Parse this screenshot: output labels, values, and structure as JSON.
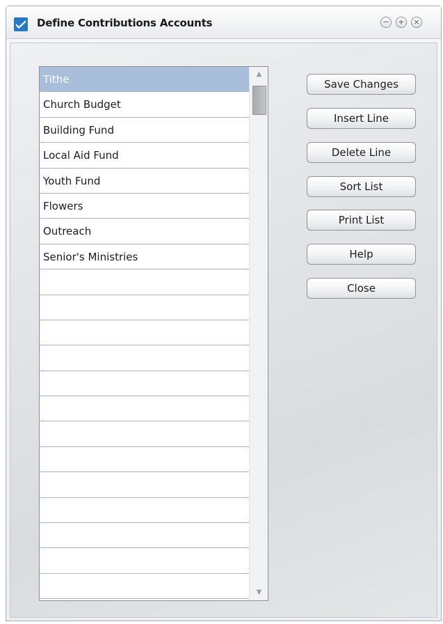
{
  "window": {
    "title": "Define Contributions Accounts",
    "controls": {
      "minimize": "−",
      "maximize": "+",
      "close": "×"
    }
  },
  "accounts": {
    "items": [
      "Tithe",
      "Church Budget",
      "Building Fund",
      "Local Aid Fund",
      "Youth Fund",
      "Flowers",
      "Outreach",
      "Senior's Ministries",
      "",
      "",
      "",
      "",
      "",
      "",
      "",
      "",
      "",
      "",
      "",
      "",
      ""
    ],
    "selected_index": 0
  },
  "buttons": {
    "save": "Save Changes",
    "insert": "Insert Line",
    "delete": "Delete Line",
    "sort": "Sort List",
    "print": "Print List",
    "help": "Help",
    "close": "Close"
  },
  "scroll": {
    "up_arrow": "▲",
    "down_arrow": "▼"
  },
  "colors": {
    "selection": "#a9bedb",
    "app_icon": "#2a78bf"
  },
  "icons": {
    "app": "checkmark-app-icon"
  }
}
